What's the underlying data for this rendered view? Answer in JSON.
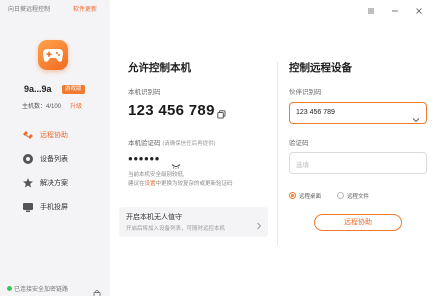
{
  "app": {
    "title": "向日葵远程控制",
    "update_label": "软件更新"
  },
  "colors": {
    "accent": "#f07a31",
    "sidebar_bg": "#f4f4f6",
    "online": "#3cc45a"
  },
  "sidebar": {
    "logo_icon": "gamepad-icon",
    "device_name": "9a...9a",
    "badge": "游戏版",
    "host_count": "主机数：4/100",
    "upgrade_label": "升级",
    "items": [
      {
        "label": "远程协助",
        "icon": "remote-assist-icon",
        "active": true
      },
      {
        "label": "设备列表",
        "icon": "device-list-icon",
        "active": false
      },
      {
        "label": "解决方案",
        "icon": "solution-icon",
        "active": false
      },
      {
        "label": "手机投屏",
        "icon": "phone-cast-icon",
        "active": false
      }
    ],
    "status_text": "已连接安全加密链路"
  },
  "allow_control": {
    "title": "允许控制本机",
    "id_label": "本机识别码",
    "id_value": "123 456 789",
    "code_label": "本机验证码",
    "code_hint": "(请确保信任后再提供)",
    "code_value": "●●●●●●",
    "note_line1": "当前本机安全级别较低,",
    "note_line2_pre": "建议在",
    "note_link": "设置",
    "note_line2_post": "中更换为较复杂的或更新验证码",
    "unattended_title": "开启本机无人值守",
    "unattended_desc": "开启后将加入设备列表，可随时远控本机"
  },
  "remote_control": {
    "title": "控制远程设备",
    "partner_label": "伙伴识别码",
    "partner_value": "123 456 789",
    "code_label": "验证码",
    "code_placeholder": "选填",
    "mode_options": [
      "远程桌面",
      "远程文件"
    ],
    "selected_mode": "远程桌面",
    "connect_label": "远程协助"
  }
}
